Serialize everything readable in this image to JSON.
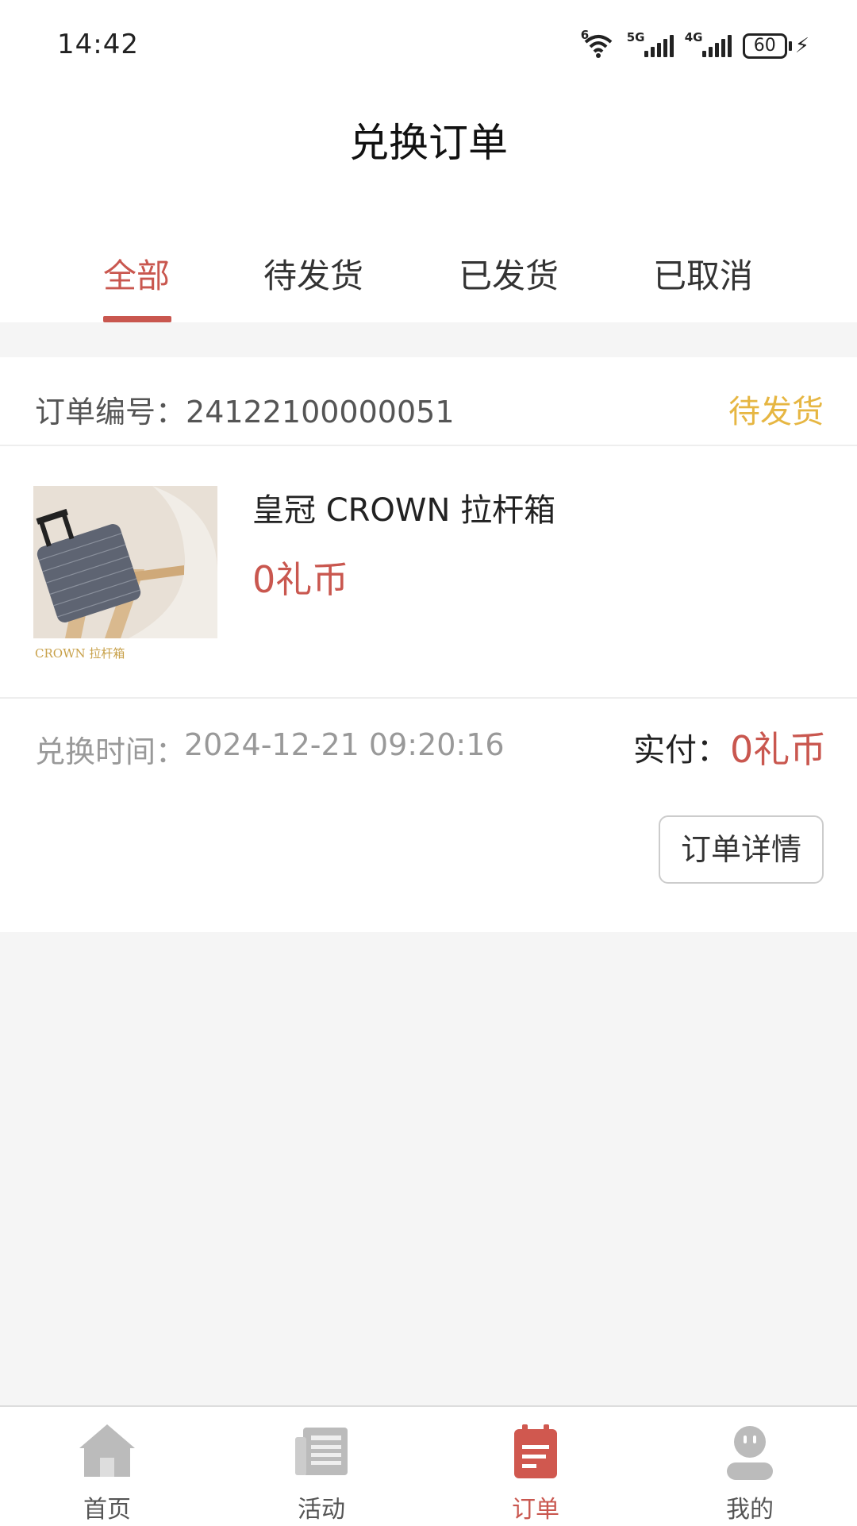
{
  "status_bar": {
    "time": "14:42",
    "wifi_tag": "6",
    "sim1_tag": "5G",
    "sim2_tag": "4G",
    "battery": "60"
  },
  "header": {
    "title": "兑换订单"
  },
  "tabs": [
    {
      "label": "全部",
      "active": true
    },
    {
      "label": "待发货",
      "active": false
    },
    {
      "label": "已发货",
      "active": false
    },
    {
      "label": "已取消",
      "active": false
    }
  ],
  "order": {
    "order_no_label": "订单编号：",
    "order_no": "24122100000051",
    "status": "待发货",
    "product_name": "皇冠 CROWN 拉杆箱",
    "thumb_caption": "CROWN 拉杆箱",
    "price": "0礼币",
    "exchange_time_label": "兑换时间：",
    "exchange_time": "2024-12-21 09:20:16",
    "paid_label": "实付：",
    "paid_value": "0礼币",
    "detail_button": "订单详情"
  },
  "bottom_nav": [
    {
      "label": "首页",
      "icon": "home-icon",
      "active": false
    },
    {
      "label": "活动",
      "icon": "news-icon",
      "active": false
    },
    {
      "label": "订单",
      "icon": "order-icon",
      "active": true
    },
    {
      "label": "我的",
      "icon": "profile-icon",
      "active": false
    }
  ],
  "colors": {
    "accent": "#c9574f",
    "pending": "#e6b642",
    "inactive_icon": "#bbbbbb"
  }
}
